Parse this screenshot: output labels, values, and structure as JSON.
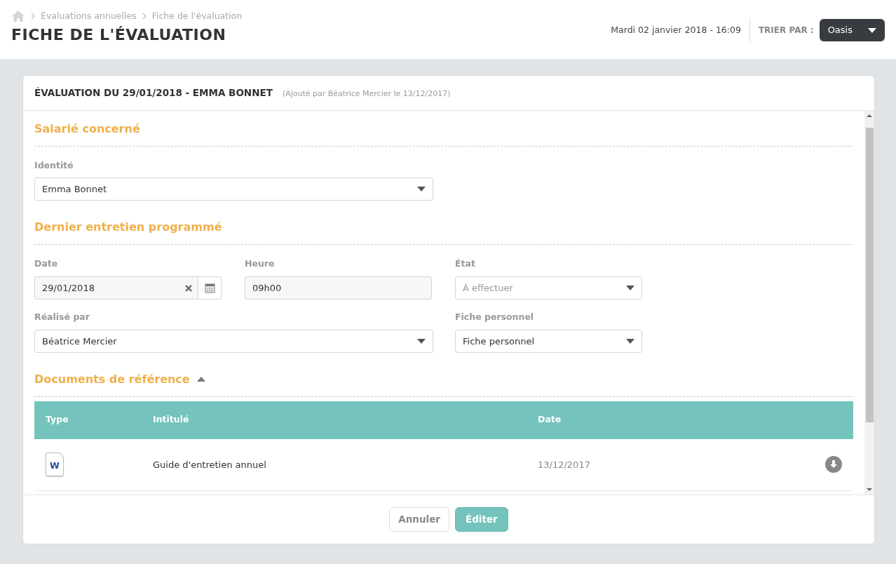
{
  "breadcrumb": [
    "Évaluations annuelles",
    "Fiche de l'évaluation"
  ],
  "page_title": "FICHE DE L'ÉVALUATION",
  "datetime": "Mardi 02 janvier 2018 - 16:09",
  "sort": {
    "label": "TRIER PAR :",
    "value": "Oasis"
  },
  "card": {
    "title": "ÉVALUATION DU 29/01/2018 - EMMA BONNET",
    "subtitle": "(Ajouté par Béatrice Mercier le 13/12/2017)"
  },
  "sections": [
    {
      "title": "Salarié concerné",
      "fields": [
        {
          "kind": "select",
          "label": "Identité",
          "value": "Emma Bonnet"
        }
      ]
    },
    {
      "title": "Dernier entretien programmé",
      "fields": [
        {
          "kind": "date",
          "label": "Date",
          "value": "29/01/2018"
        },
        {
          "kind": "text",
          "label": "Heure",
          "value": "09h00"
        },
        {
          "kind": "select",
          "label": "État",
          "placeholder": "À effectuer"
        },
        {
          "kind": "select",
          "label": "Réalisé par",
          "value": "Béatrice Mercier"
        },
        {
          "kind": "select",
          "label": "Fiche personnel",
          "value": "Fiche personnel"
        }
      ]
    }
  ],
  "documents": {
    "title": "Documents de référence",
    "expanded": true,
    "columns": [
      "Type",
      "Intitulé",
      "Date"
    ],
    "rows": [
      {
        "type_letter": "W",
        "title": "Guide d'entretien annuel",
        "date": "13/12/2017"
      }
    ]
  },
  "buttons": [
    {
      "label": "Annuler",
      "kind": "secondary"
    },
    {
      "label": "Éditer",
      "kind": "primary"
    }
  ]
}
